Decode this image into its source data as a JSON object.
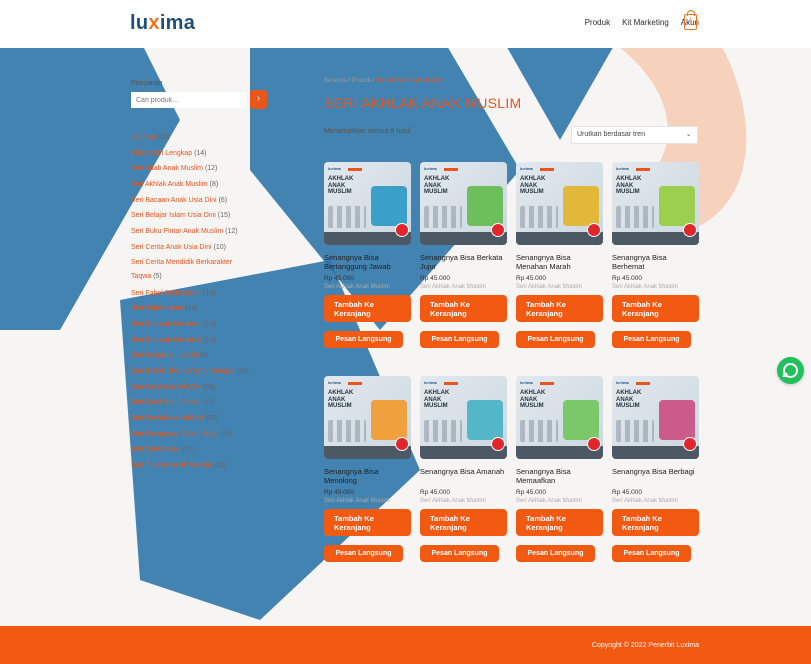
{
  "header": {
    "logo": "luxima",
    "nav": [
      "Produk",
      "Kit Marketing",
      "Akun"
    ],
    "cart_count": "1"
  },
  "sidebar": {
    "search_label": "Pencarian",
    "search_placeholder": "Cari produk...",
    "categories": [
      {
        "name": "Lainnya",
        "count": "(10)"
      },
      {
        "name": "Paket Seri Lengkap",
        "count": "(14)"
      },
      {
        "name": "Seri Adab Anak Muslim",
        "count": "(12)"
      },
      {
        "name": "Seri Akhlak Anak Muslim",
        "count": "(8)"
      },
      {
        "name": "Seri Bacaan Anak Usia Dini",
        "count": "(6)"
      },
      {
        "name": "Seri Belajar Islam Usia Dini",
        "count": "(15)"
      },
      {
        "name": "Seri Buku Pintar Anak Muslim",
        "count": "(12)"
      },
      {
        "name": "Seri Cerita Anak Usia Dini",
        "count": "(10)"
      },
      {
        "name": "Seri Cerita Mendidik Berkarakter Taqwa",
        "count": "(5)"
      },
      {
        "name": "Seri Fabel Berkarakter",
        "count": "(10)"
      },
      {
        "name": "Seri Fabel Islami",
        "count": "(10)"
      },
      {
        "name": "Seri Ilmuwan Muslim 1",
        "count": "(10)"
      },
      {
        "name": "Seri Ilmuwan Muslim 2",
        "count": "(10)"
      },
      {
        "name": "Seri Keajaiban Langit",
        "count": "(8)"
      },
      {
        "name": "Seri Komik Nilai Karakter Bangsa",
        "count": "(18)"
      },
      {
        "name": "Seri Paud Formal (TK)",
        "count": "(24)"
      },
      {
        "name": "Seri Paud Non Formal",
        "count": "(16)"
      },
      {
        "name": "Seri Pendidikan Inklusif",
        "count": "(35)"
      },
      {
        "name": "Seri Pengayaan Guru Paud",
        "count": "(18)"
      },
      {
        "name": "Seri Sains Anak",
        "count": "(15)"
      },
      {
        "name": "Seri Teladan Anak Muslim",
        "count": "(10)"
      }
    ]
  },
  "content": {
    "breadcrumb": [
      "Beranda",
      "Produk",
      "Seri Akhlak Anak Muslim"
    ],
    "title": "SERI AKHLAK ANAK MUSLIM",
    "result_count": "Menampilkan semua 8 hasil",
    "sort_label": "Urutkan berdasar tren"
  },
  "products": [
    {
      "name": "Senangnya Bisa Bertanggung Jawab",
      "price": "Rp 45.000",
      "category": "Seri Akhlak Anak Muslim",
      "cover_title": "AKHLAK ANAK MUSLIM",
      "art_color": "#3aa0c8"
    },
    {
      "name": "Senangnya Bisa Berkata Jujur",
      "price": "Rp 45.000",
      "category": "Seri Akhlak Anak Muslim",
      "cover_title": "AKHLAK ANAK MUSLIM",
      "art_color": "#6cbf5a"
    },
    {
      "name": "Senangnya Bisa Menahan Marah",
      "price": "Rp 45.000",
      "category": "Seri Akhlak Anak Muslim",
      "cover_title": "AKHLAK ANAK MUSLIM",
      "art_color": "#e2b83a"
    },
    {
      "name": "Senangnya Bisa Berhemat",
      "price": "Rp 45.000",
      "category": "Seri Akhlak Anak Muslim",
      "cover_title": "AKHLAK ANAK MUSLIM",
      "art_color": "#9ccf4e"
    },
    {
      "name": "Senangnya Bisa Menolong",
      "price": "Rp 45.000",
      "category": "Seri Akhlak Anak Muslim",
      "cover_title": "AKHLAK ANAK MUSLIM",
      "art_color": "#f0a03c"
    },
    {
      "name": "Senangnya Bisa Amanah",
      "price": "Rp 45.000",
      "category": "Seri Akhlak Anak Muslim",
      "cover_title": "AKHLAK ANAK MUSLIM",
      "art_color": "#53b6c9"
    },
    {
      "name": "Senangnya Bisa Memaafkan",
      "price": "Rp 45.000",
      "category": "Seri Akhlak Anak Muslim",
      "cover_title": "AKHLAK ANAK MUSLIM",
      "art_color": "#7ac86a"
    },
    {
      "name": "Senangnya Bisa Berbagi",
      "price": "Rp 45.000",
      "category": "Seri Akhlak Anak Muslim",
      "cover_title": "AKHLAK ANAK MUSLIM",
      "art_color": "#cc5a8a"
    }
  ],
  "buttons": {
    "add_to_cart": "Tambah Ke Keranjang",
    "buy_now": "Pesan Langsung"
  },
  "footer": {
    "copyright": "Copyright © 2022 Penerbit Luxima"
  },
  "colors": {
    "accent": "#f25a12",
    "brand_blue": "#1f4f7a",
    "whatsapp": "#22c05d"
  }
}
